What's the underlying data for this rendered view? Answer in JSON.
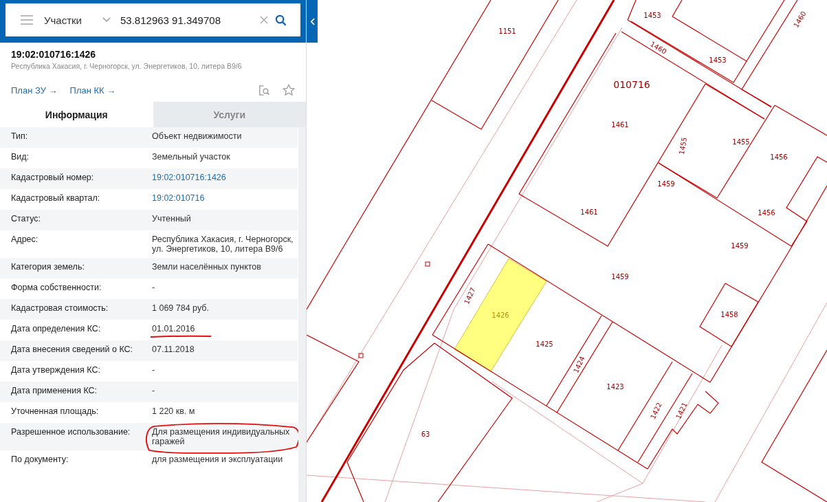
{
  "search": {
    "layer": "Участки",
    "value": "53.812963 91.349708"
  },
  "object": {
    "number": "19:02:010716:1426",
    "address": "Республика Хакасия, г. Черногорск, ул. Энергетиков, 10, литера В9/6",
    "links": [
      "План ЗУ →",
      "План КК →"
    ]
  },
  "tabs": [
    {
      "label": "Информация",
      "selected": true
    },
    {
      "label": "Услуги",
      "selected": false
    }
  ],
  "rows": [
    {
      "label": "Тип:",
      "value": "Объект недвижимости",
      "link": false,
      "underlined": false,
      "circled": false
    },
    {
      "label": "Вид:",
      "value": "Земельный участок",
      "link": false,
      "underlined": false,
      "circled": false
    },
    {
      "label": "Кадастровый номер:",
      "value": "19:02:010716:1426",
      "link": true,
      "underlined": false,
      "circled": false
    },
    {
      "label": "Кадастровый квартал:",
      "value": "19:02:010716",
      "link": true,
      "underlined": false,
      "circled": false
    },
    {
      "label": "Статус:",
      "value": "Учтенный",
      "link": false,
      "underlined": false,
      "circled": false
    },
    {
      "label": "Адрес:",
      "value": "Республика Хакасия, г. Черногорск, ул. Энергетиков, 10, литера В9/6",
      "link": false,
      "underlined": false,
      "circled": false
    },
    {
      "label": "Категория земель:",
      "value": "Земли населённых пунктов",
      "link": false,
      "underlined": false,
      "circled": false
    },
    {
      "label": "Форма собственности:",
      "value": "-",
      "link": false,
      "underlined": false,
      "circled": false
    },
    {
      "label": "Кадастровая стоимость:",
      "value": "1 069 784 руб.",
      "link": false,
      "underlined": false,
      "circled": false
    },
    {
      "label": "Дата определения КС:",
      "value": "01.01.2016",
      "link": false,
      "underlined": true,
      "circled": false
    },
    {
      "label": "Дата внесения сведений о КС:",
      "value": "07.11.2018",
      "link": false,
      "underlined": false,
      "circled": false
    },
    {
      "label": "Дата утверждения КС:",
      "value": "-",
      "link": false,
      "underlined": false,
      "circled": false
    },
    {
      "label": "Дата применения КС:",
      "value": "-",
      "link": false,
      "underlined": false,
      "circled": false
    },
    {
      "label": "Уточненная площадь:",
      "value": "1 220 кв. м",
      "link": false,
      "underlined": false,
      "circled": false
    },
    {
      "label": "Разрешенное использование:",
      "value": "Для размещения индивидуальных гаражей",
      "link": false,
      "underlined": false,
      "circled": true
    },
    {
      "label": "По документу:",
      "value": "для размещения и эксплуатации",
      "link": false,
      "underlined": false,
      "circled": false
    }
  ],
  "map": {
    "quarter": "010716",
    "parcels": [
      {
        "label": "1151",
        "selected": false
      },
      {
        "label": "1453",
        "selected": false
      },
      {
        "label": "1460",
        "selected": false
      },
      {
        "label": "1460",
        "selected": false
      },
      {
        "label": "1453",
        "selected": false
      },
      {
        "label": "1461",
        "selected": false
      },
      {
        "label": "1455",
        "selected": false
      },
      {
        "label": "1455",
        "selected": false
      },
      {
        "label": "1456",
        "selected": false
      },
      {
        "label": "1459",
        "selected": false
      },
      {
        "label": "1461",
        "selected": false
      },
      {
        "label": "1456",
        "selected": false
      },
      {
        "label": "1459",
        "selected": false
      },
      {
        "label": "1459",
        "selected": false
      },
      {
        "label": "1427",
        "selected": false
      },
      {
        "label": "1426",
        "selected": true
      },
      {
        "label": "1458",
        "selected": false
      },
      {
        "label": "1425",
        "selected": false
      },
      {
        "label": "1424",
        "selected": false
      },
      {
        "label": "1423",
        "selected": false
      },
      {
        "label": "1422",
        "selected": false
      },
      {
        "label": "1421",
        "selected": false
      },
      {
        "label": "63",
        "selected": false
      }
    ]
  }
}
